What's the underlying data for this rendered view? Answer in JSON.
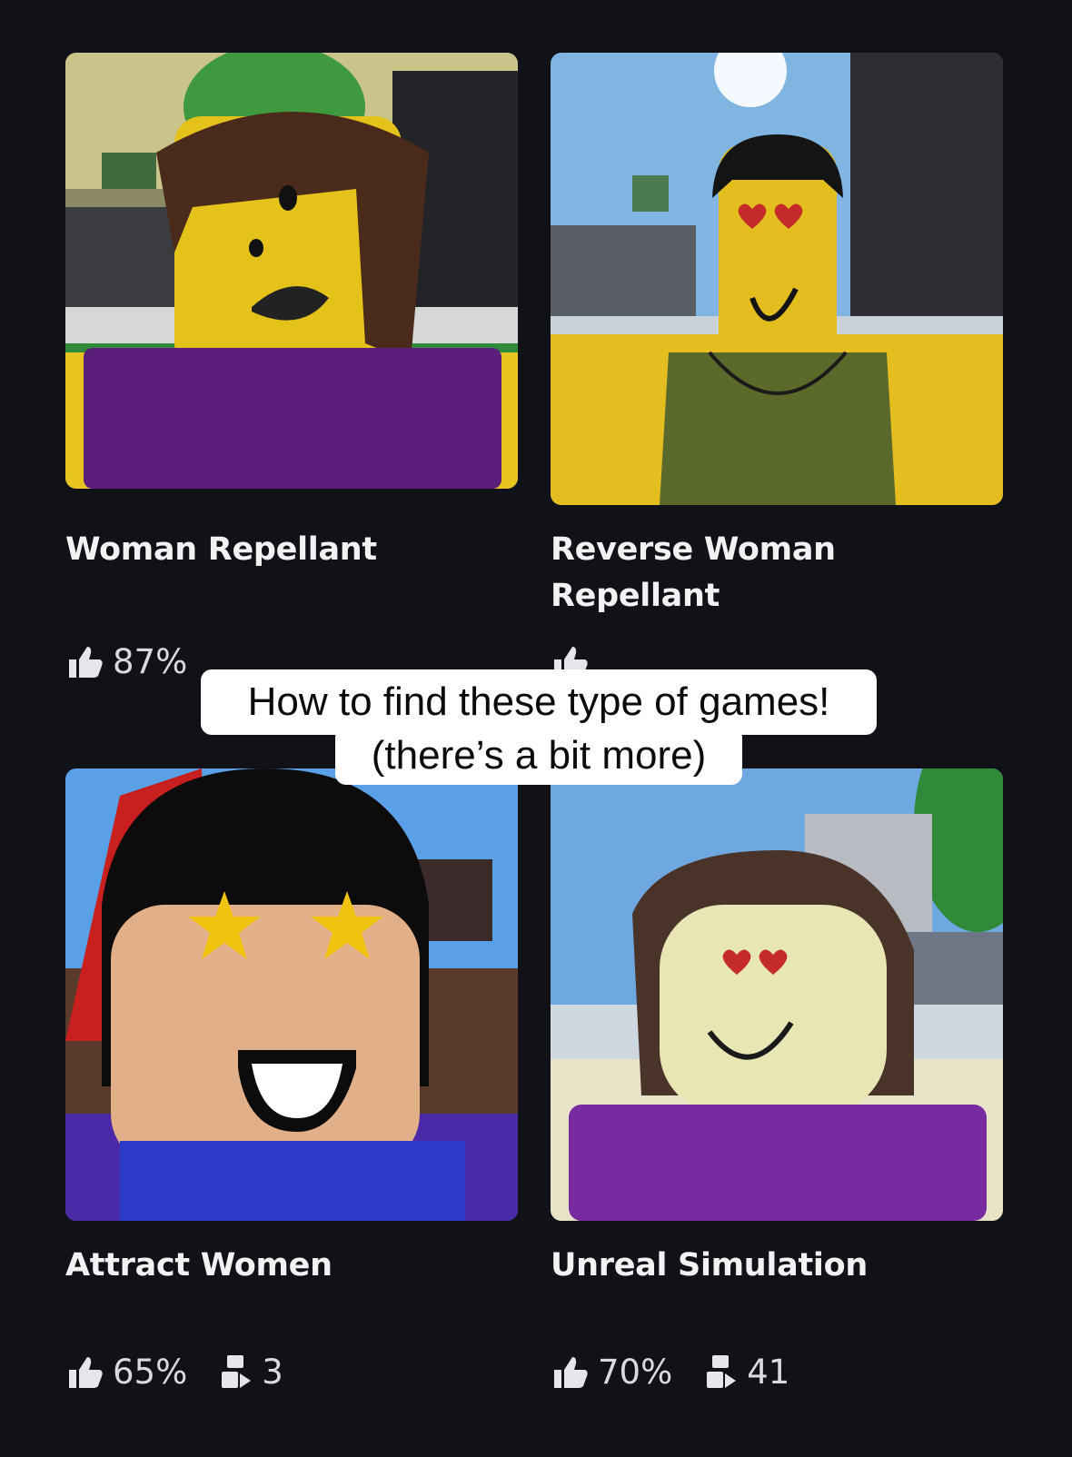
{
  "overlay": {
    "line1": "How to find these type of games!",
    "line2": "(there’s a bit more)"
  },
  "games": [
    {
      "title": "Woman Repellant",
      "rating": "87%",
      "players": "",
      "thumbnail": "roblox-avatar-confused-face-purple-shirt"
    },
    {
      "title": "Reverse Woman Repellant",
      "rating": "",
      "players": "",
      "thumbnail": "roblox-avatar-heart-eyes-green-tank-top"
    },
    {
      "title": "Attract Women",
      "rating": "65%",
      "players": "3",
      "thumbnail": "roblox-avatar-star-eyes-blue-shirt"
    },
    {
      "title": "Unreal Simulation",
      "rating": "70%",
      "players": "41",
      "thumbnail": "roblox-avatar-heart-eyes-purple-shirt-blurred"
    }
  ],
  "icons": {
    "rating": "thumbs-up-icon",
    "players": "players-icon"
  },
  "colors": {
    "background": "#111217",
    "caption_bg": "#ffffff",
    "text": "#f2f2f4"
  }
}
